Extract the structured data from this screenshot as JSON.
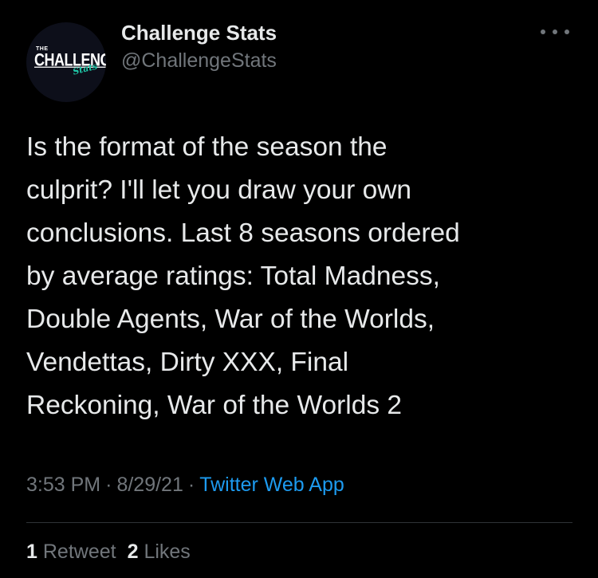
{
  "author": {
    "avatar_logo": {
      "line1": "THE",
      "line2": "CHALLENGE",
      "line3": "Stats"
    },
    "display_name": "Challenge Stats",
    "handle": "@ChallengeStats"
  },
  "more_icon": "more-horizontal-icon",
  "tweet": {
    "text": "Is the format of the season the\nculprit? I'll let you draw your own\nconclusions. Last 8 seasons ordered\nby average ratings: Total Madness,\nDouble Agents, War of the Worlds,\nVendettas, Dirty XXX, Final\nReckoning, War of the Worlds 2"
  },
  "meta": {
    "time": "3:53 PM",
    "separator": "·",
    "date": "8/29/21",
    "source": "Twitter Web App"
  },
  "stats": {
    "retweets_count": "1",
    "retweets_label": "Retweet",
    "likes_count": "2",
    "likes_label": "Likes"
  },
  "colors": {
    "background": "#000000",
    "text": "#e7e9ea",
    "secondary": "#71767b",
    "link": "#1d9bf0",
    "divider": "#2f3336"
  }
}
